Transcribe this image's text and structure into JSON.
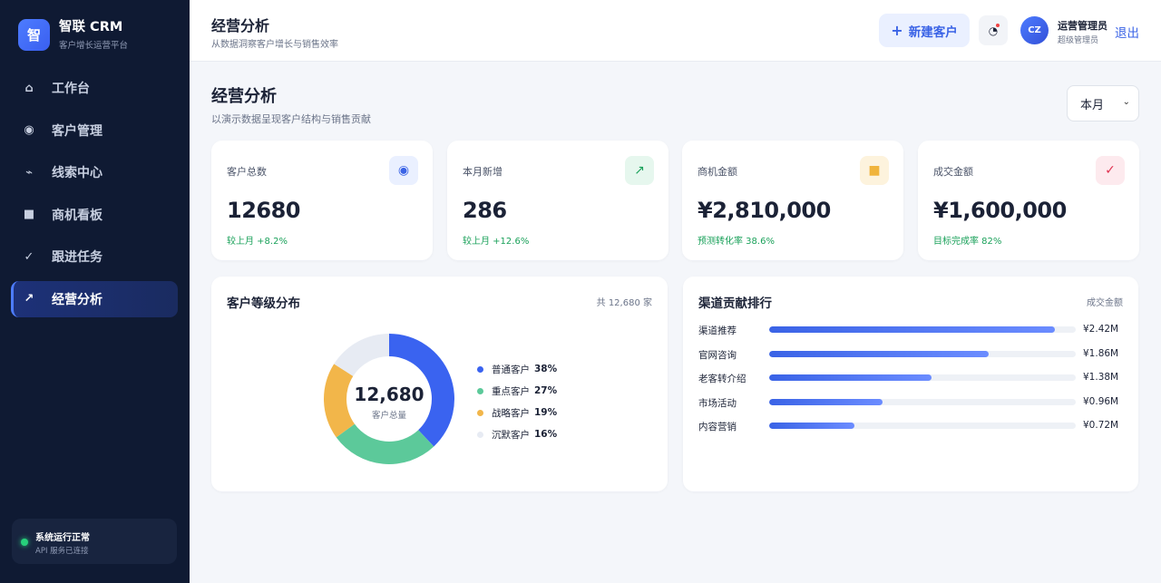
{
  "brand": {
    "logo": "智",
    "name": "智联 CRM",
    "subtitle": "客户增长运营平台"
  },
  "sidebar": {
    "items": [
      {
        "label": "工作台",
        "icon": "home-icon",
        "glyph": "⌂",
        "active": false
      },
      {
        "label": "客户管理",
        "icon": "customer-icon",
        "glyph": "◉",
        "active": false
      },
      {
        "label": "线索中心",
        "icon": "leads-icon",
        "glyph": "⌁",
        "active": false
      },
      {
        "label": "商机看板",
        "icon": "board-icon",
        "glyph": "■",
        "active": false
      },
      {
        "label": "跟进任务",
        "icon": "check-icon",
        "glyph": "✓",
        "active": false
      },
      {
        "label": "经营分析",
        "icon": "trend-icon",
        "glyph": "↗",
        "active": true
      }
    ],
    "status": {
      "title": "系统运行正常",
      "subtitle": "API 服务已连接"
    }
  },
  "header": {
    "title": "经营分析",
    "subtitle": "从数据洞察客户增长与销售效率",
    "new_button": "新建客户",
    "new_button_icon": "+",
    "notify_glyph": "◔",
    "avatar": "CZ",
    "user_name": "运营管理员",
    "user_role": "超级管理员",
    "logout": "退出"
  },
  "page": {
    "title": "经营分析",
    "subtitle": "以演示数据呈现客户结构与销售贡献",
    "period": {
      "selected": "本月"
    }
  },
  "stats": [
    {
      "label": "客户总数",
      "value": "12680",
      "note": "较上月 +8.2%",
      "icon": "target-icon",
      "glyph": "◉",
      "icon_color": "#3a63e6",
      "icon_bg": "#eaf0ff"
    },
    {
      "label": "本月新增",
      "value": "286",
      "note": "较上月 +12.6%",
      "icon": "trend-up-icon",
      "glyph": "↗",
      "icon_color": "#1aa15a",
      "icon_bg": "#e6f7ee"
    },
    {
      "label": "商机金额",
      "value": "¥2,810,000",
      "note": "预测转化率 38.6%",
      "icon": "square-icon",
      "glyph": "■",
      "icon_color": "#f0b43c",
      "icon_bg": "#fdf3dd"
    },
    {
      "label": "成交金额",
      "value": "¥1,600,000",
      "note": "目标完成率 82%",
      "icon": "check-icon",
      "glyph": "✓",
      "icon_color": "#e0314f",
      "icon_bg": "#fdeaee"
    }
  ],
  "distribution": {
    "title": "客户等级分布",
    "total_note": "共 12,680 家",
    "center_value": "12,680",
    "center_label": "客户总量"
  },
  "channels": {
    "title": "渠道贡献排行",
    "side_label": "成交金额"
  },
  "chart_data": [
    {
      "type": "pie",
      "title": "客户等级分布",
      "categories": [
        "普通客户",
        "重点客户",
        "战略客户",
        "沉默客户"
      ],
      "values": [
        38,
        27,
        19,
        16
      ],
      "labels": [
        "38%",
        "27%",
        "19%",
        "16%"
      ],
      "colors": [
        "#3a63f0",
        "#5cc99a",
        "#f2b64a",
        "#e7ebf3"
      ]
    },
    {
      "type": "bar",
      "title": "渠道贡献排行",
      "categories": [
        "渠道推荐",
        "官网咨询",
        "老客转介绍",
        "市场活动",
        "内容营销"
      ],
      "values": [
        2.42,
        1.86,
        1.38,
        0.96,
        0.72
      ],
      "labels": [
        "¥2.42M",
        "¥1.86M",
        "¥1.38M",
        "¥0.96M",
        "¥0.72M"
      ],
      "xlim": [
        0,
        2.6
      ]
    }
  ]
}
